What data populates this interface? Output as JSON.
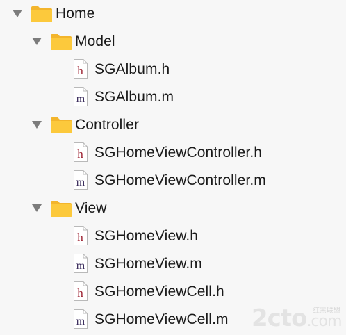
{
  "tree": {
    "home": {
      "label": "Home",
      "icon": "folder-icon"
    },
    "model": {
      "label": "Model",
      "icon": "folder-icon",
      "files": [
        {
          "label": "SGAlbum.h",
          "icon_letter": "h"
        },
        {
          "label": "SGAlbum.m",
          "icon_letter": "m"
        }
      ]
    },
    "controller": {
      "label": "Controller",
      "icon": "folder-icon",
      "files": [
        {
          "label": "SGHomeViewController.h",
          "icon_letter": "h"
        },
        {
          "label": "SGHomeViewController.m",
          "icon_letter": "m"
        }
      ]
    },
    "view": {
      "label": "View",
      "icon": "folder-icon",
      "files": [
        {
          "label": "SGHomeView.h",
          "icon_letter": "h"
        },
        {
          "label": "SGHomeView.m",
          "icon_letter": "m"
        },
        {
          "label": "SGHomeViewCell.h",
          "icon_letter": "h"
        },
        {
          "label": "SGHomeViewCell.m",
          "icon_letter": "m"
        }
      ]
    }
  },
  "watermark": {
    "main": "2cto",
    "suffix": ".com",
    "sub": "红黑联盟"
  },
  "colors": {
    "folder": "#fcc93c",
    "folder_tab": "#f3b52c",
    "header_letter": "#9a1b2b",
    "impl_letter": "#3d2f5e",
    "disclosure": "#7c7c7c",
    "background": "#f7f7f7"
  }
}
